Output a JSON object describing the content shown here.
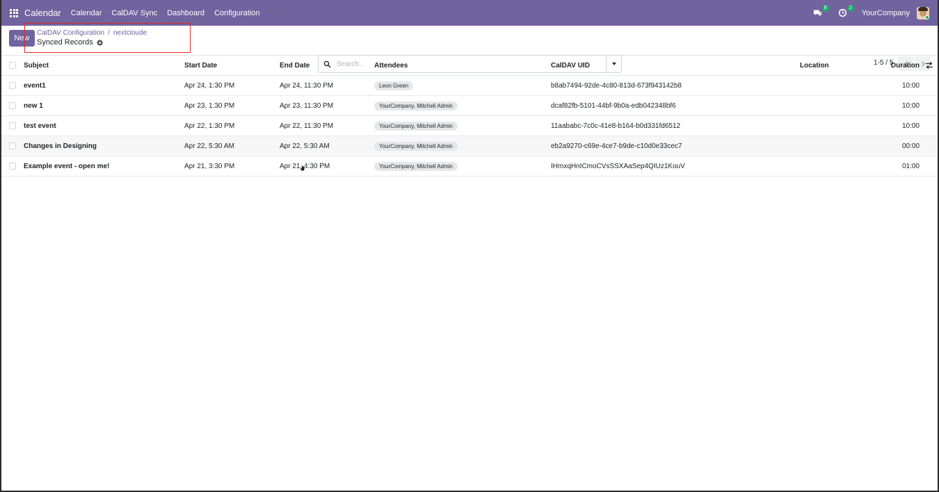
{
  "nav": {
    "brand": "Calendar",
    "menu": [
      "Calendar",
      "CalDAV Sync",
      "Dashboard",
      "Configuration"
    ],
    "messages_count": "8",
    "activities_count": "2",
    "company": "YourCompany"
  },
  "control": {
    "new_label": "New",
    "breadcrumb": [
      "CalDAV Configuration",
      "nextcloude"
    ],
    "view_title": "Synced Records",
    "search_placeholder": "Search...",
    "pager": "1-5 / 5"
  },
  "table": {
    "headers": {
      "subject": "Subject",
      "start": "Start Date",
      "end": "End Date",
      "attendees": "Attendees",
      "uid": "CalDAV UID",
      "location": "Location",
      "duration": "Duration"
    },
    "rows": [
      {
        "subject": "event1",
        "start": "Apr 24, 1:30 PM",
        "end": "Apr 24, 11:30 PM",
        "attendees": "Leon Green",
        "uid": "b8ab7494-92de-4c80-813d-673f943142b8",
        "location": "",
        "duration": "10:00"
      },
      {
        "subject": "new 1",
        "start": "Apr 23, 1:30 PM",
        "end": "Apr 23, 11:30 PM",
        "attendees": "YourCompany, Mitchell Admin",
        "uid": "dcaf82fb-5101-44bf-9b0a-edb042348bf6",
        "location": "",
        "duration": "10:00"
      },
      {
        "subject": "test event",
        "start": "Apr 22, 1:30 PM",
        "end": "Apr 22, 11:30 PM",
        "attendees": "YourCompany, Mitchell Admin",
        "uid": "11aababc-7c0c-41e8-b164-b0d331fd6512",
        "location": "",
        "duration": "10:00"
      },
      {
        "subject": "Changes in Designing",
        "start": "Apr 22, 5:30 AM",
        "end": "Apr 22, 5:30 AM",
        "attendees": "YourCompany, Mitchell Admin",
        "uid": "eb2a9270-c69e-4ce7-b9de-c10d0e33cec7",
        "location": "",
        "duration": "00:00"
      },
      {
        "subject": "Example event - open me!",
        "start": "Apr 21, 3:30 PM",
        "end": "Apr 21, 4:30 PM",
        "attendees": "YourCompany, Mitchell Admin",
        "uid": "IHmxqHnICmoCVsSSXAaSep4QIUz1KouV",
        "location": "",
        "duration": "01:00"
      }
    ]
  },
  "colors": {
    "brand_purple": "#71639e",
    "badge_green": "#21a86d",
    "highlight_red": "#e02424"
  }
}
